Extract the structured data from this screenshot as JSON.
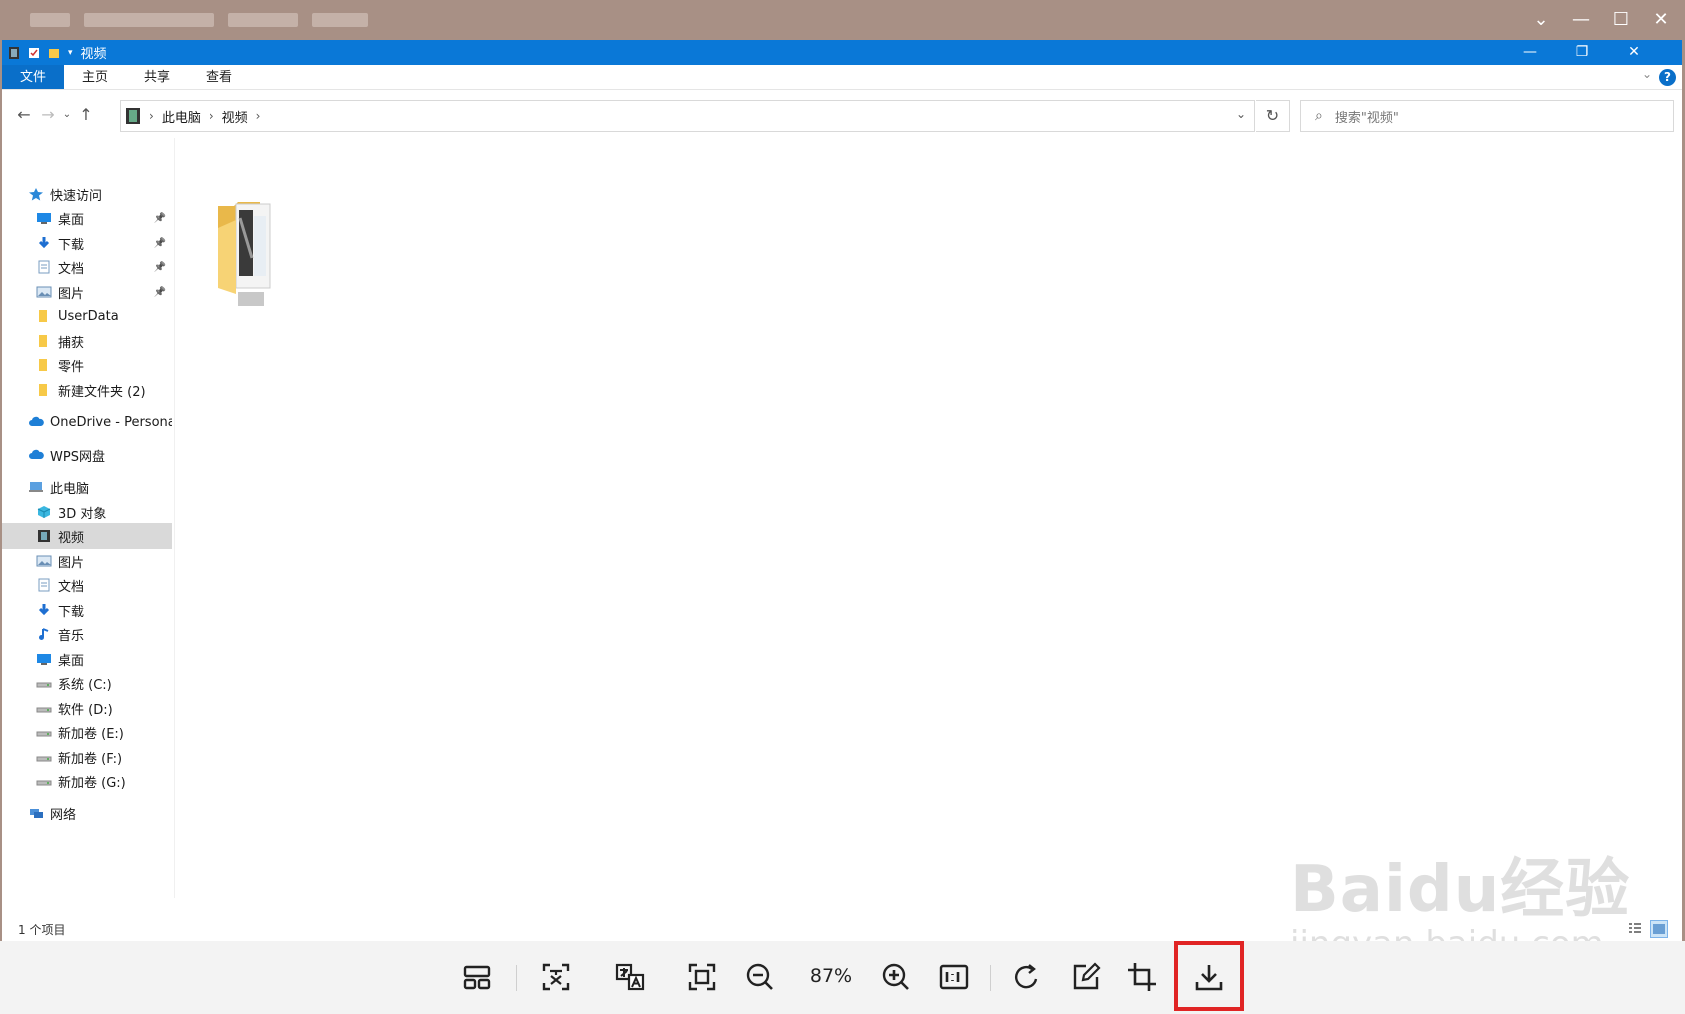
{
  "outer": {
    "controls": {
      "collapse": "⌄",
      "minimize": "—",
      "maximize": "☐",
      "close": "✕"
    }
  },
  "window": {
    "title": "视频",
    "controls": {
      "minimize": "—",
      "restore": "❐",
      "close": "✕"
    }
  },
  "ribbon": {
    "tabs": [
      "文件",
      "主页",
      "共享",
      "查看"
    ],
    "help": "?"
  },
  "address": {
    "crumbs": [
      "此电脑",
      "视频"
    ],
    "search_placeholder": "搜索\"视频\""
  },
  "nav": {
    "items": [
      {
        "label": "快速访问",
        "icon": "star-icon",
        "level": 0
      },
      {
        "label": "桌面",
        "icon": "desktop-icon",
        "level": 1,
        "pinned": true
      },
      {
        "label": "下载",
        "icon": "download-icon",
        "level": 1,
        "pinned": true
      },
      {
        "label": "文档",
        "icon": "document-icon",
        "level": 1,
        "pinned": true
      },
      {
        "label": "图片",
        "icon": "pictures-icon",
        "level": 1,
        "pinned": true
      },
      {
        "label": "UserData",
        "icon": "folder-icon",
        "level": 1
      },
      {
        "label": "捕获",
        "icon": "folder-icon",
        "level": 1
      },
      {
        "label": "零件",
        "icon": "folder-icon",
        "level": 1
      },
      {
        "label": "新建文件夹 (2)",
        "icon": "folder-icon",
        "level": 1
      },
      {
        "label": "OneDrive - Persona",
        "icon": "cloud-icon",
        "level": 0
      },
      {
        "label": "WPS网盘",
        "icon": "cloud-icon",
        "level": 0
      },
      {
        "label": "此电脑",
        "icon": "computer-icon",
        "level": 0
      },
      {
        "label": "3D 对象",
        "icon": "cube-icon",
        "level": 1
      },
      {
        "label": "视频",
        "icon": "video-icon",
        "level": 1,
        "selected": true
      },
      {
        "label": "图片",
        "icon": "pictures-icon",
        "level": 1
      },
      {
        "label": "文档",
        "icon": "document-icon",
        "level": 1
      },
      {
        "label": "下载",
        "icon": "download-icon",
        "level": 1
      },
      {
        "label": "音乐",
        "icon": "music-icon",
        "level": 1
      },
      {
        "label": "桌面",
        "icon": "desktop-icon",
        "level": 1
      },
      {
        "label": "系统 (C:)",
        "icon": "drive-icon",
        "level": 1
      },
      {
        "label": "软件 (D:)",
        "icon": "drive-icon",
        "level": 1
      },
      {
        "label": "新加卷 (E:)",
        "icon": "drive-icon",
        "level": 1
      },
      {
        "label": "新加卷 (F:)",
        "icon": "drive-icon",
        "level": 1
      },
      {
        "label": "新加卷 (G:)",
        "icon": "drive-icon",
        "level": 1
      },
      {
        "label": "网络",
        "icon": "network-icon",
        "level": 0
      }
    ]
  },
  "status": {
    "count": "1 个项目"
  },
  "viewer": {
    "zoom": "87%",
    "tools": [
      "layout",
      "ocr",
      "translate",
      "fit",
      "zoom-out",
      "zoom-in",
      "actual-size",
      "rotate",
      "edit",
      "crop",
      "download"
    ],
    "highlight_color": "#e02424"
  },
  "watermark": {
    "line1": "Baidu经验",
    "line2": "jingyan.baidu.com"
  },
  "colors": {
    "accent": "#0a78d7",
    "selected": "#d9d9d9"
  }
}
